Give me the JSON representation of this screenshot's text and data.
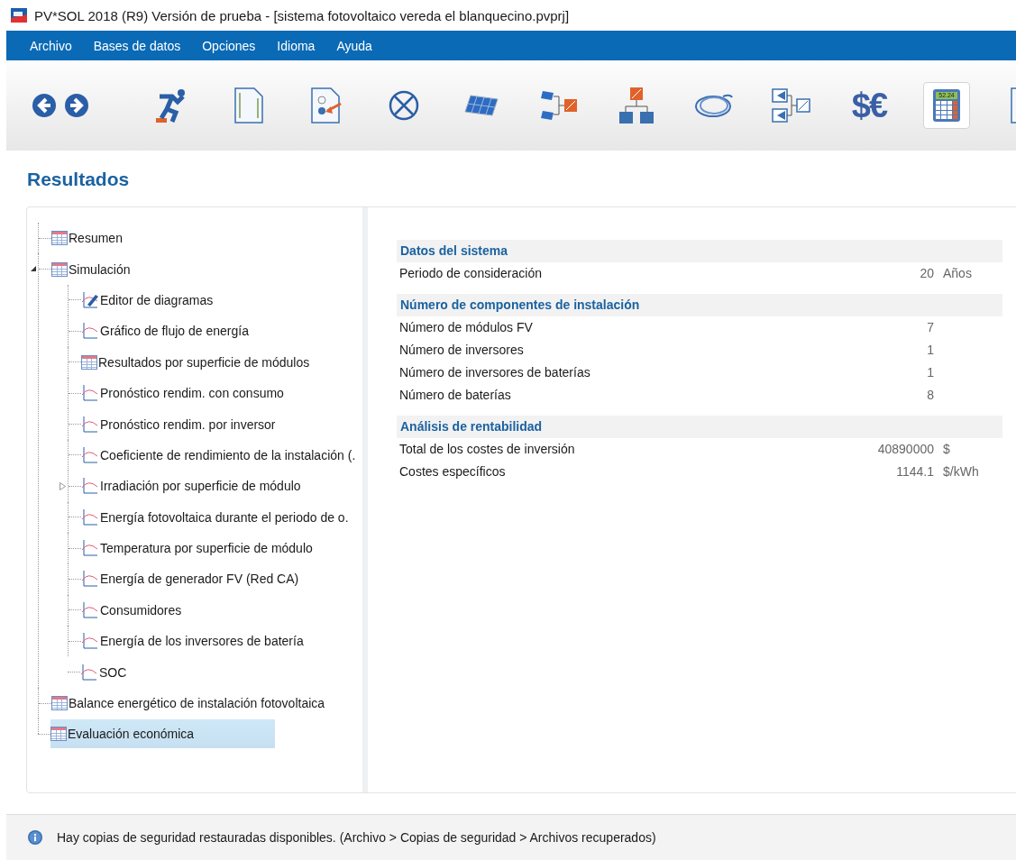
{
  "window": {
    "title": "PV*SOL 2018 (R9) Versión de prueba - [sistema fotovoltaico vereda el blanquecino.pvprj]"
  },
  "menu": [
    "Archivo",
    "Bases de datos",
    "Opciones",
    "Idioma",
    "Ayuda"
  ],
  "toolbar": [
    {
      "kind": "back",
      "selected": false
    },
    {
      "kind": "forward",
      "selected": false
    },
    {
      "kind": "runner",
      "selected": false
    },
    {
      "kind": "page",
      "selected": false
    },
    {
      "kind": "pagearrow",
      "selected": false
    },
    {
      "kind": "crosscircle",
      "selected": false
    },
    {
      "kind": "panel",
      "selected": false
    },
    {
      "kind": "modinv",
      "selected": false
    },
    {
      "kind": "invtree",
      "selected": false
    },
    {
      "kind": "cable",
      "selected": false
    },
    {
      "kind": "invpair",
      "selected": false
    },
    {
      "kind": "currency",
      "glyph": "$€",
      "selected": false
    },
    {
      "kind": "calculator",
      "display": "52.24",
      "selected": true
    },
    {
      "kind": "chartpage",
      "selected": false
    }
  ],
  "page_title": "Resultados",
  "tree": [
    {
      "label": "Resumen",
      "kind": "table",
      "selected": false
    },
    {
      "label": "Simulación",
      "kind": "table",
      "selected": false,
      "expanded": true,
      "children": [
        {
          "label": "Editor de diagramas",
          "kind": "editor",
          "selected": false
        },
        {
          "label": "Gráfico de flujo de energía",
          "kind": "chart",
          "selected": false
        },
        {
          "label": "Resultados por superficie de módulos",
          "kind": "table",
          "selected": false
        },
        {
          "label": "Pronóstico rendim. con consumo",
          "kind": "chart",
          "selected": false
        },
        {
          "label": "Pronóstico rendim. por inversor",
          "kind": "chart",
          "selected": false
        },
        {
          "label": "Coeficiente de rendimiento de la instalación (.",
          "kind": "chart",
          "selected": false
        },
        {
          "label": "Irradiación por superficie de módulo",
          "kind": "chart",
          "selected": false,
          "expanded": false
        },
        {
          "label": "Energía fotovoltaica durante el periodo de o.",
          "kind": "chart",
          "selected": false
        },
        {
          "label": "Temperatura por superficie de módulo",
          "kind": "chart",
          "selected": false
        },
        {
          "label": "Energía de generador FV (Red CA)",
          "kind": "chart",
          "selected": false
        },
        {
          "label": "Consumidores",
          "kind": "chart",
          "selected": false
        },
        {
          "label": "Energía de los inversores de batería",
          "kind": "chart",
          "selected": false
        },
        {
          "label": "SOC",
          "kind": "chart",
          "selected": false
        }
      ]
    },
    {
      "label": "Balance energético de instalación fotovoltaica",
      "kind": "table",
      "selected": false
    },
    {
      "label": "Evaluación económica",
      "kind": "table",
      "selected": true
    }
  ],
  "sections": [
    {
      "title": "Datos del sistema",
      "rows": [
        {
          "label": "Periodo de consideración",
          "value": "20",
          "unit": "Años"
        }
      ]
    },
    {
      "title": "Número de componentes de instalación",
      "rows": [
        {
          "label": "Número de módulos FV",
          "value": "7"
        },
        {
          "label": "Número de inversores",
          "value": "1"
        },
        {
          "label": "Número de inversores de baterías",
          "value": "1"
        },
        {
          "label": "Número de baterías",
          "value": "8"
        }
      ]
    },
    {
      "title": "Análisis de rentabilidad",
      "rows": [
        {
          "label": "Total de los costes de inversión",
          "value": "40890000",
          "unit": "$"
        },
        {
          "label": "Costes específicos",
          "value": "1144.1",
          "unit": "$/kWh"
        }
      ]
    }
  ],
  "status_bar": {
    "message": "Hay copias de seguridad restauradas disponibles. (Archivo > Copias de seguridad > Archivos recuperados)"
  }
}
